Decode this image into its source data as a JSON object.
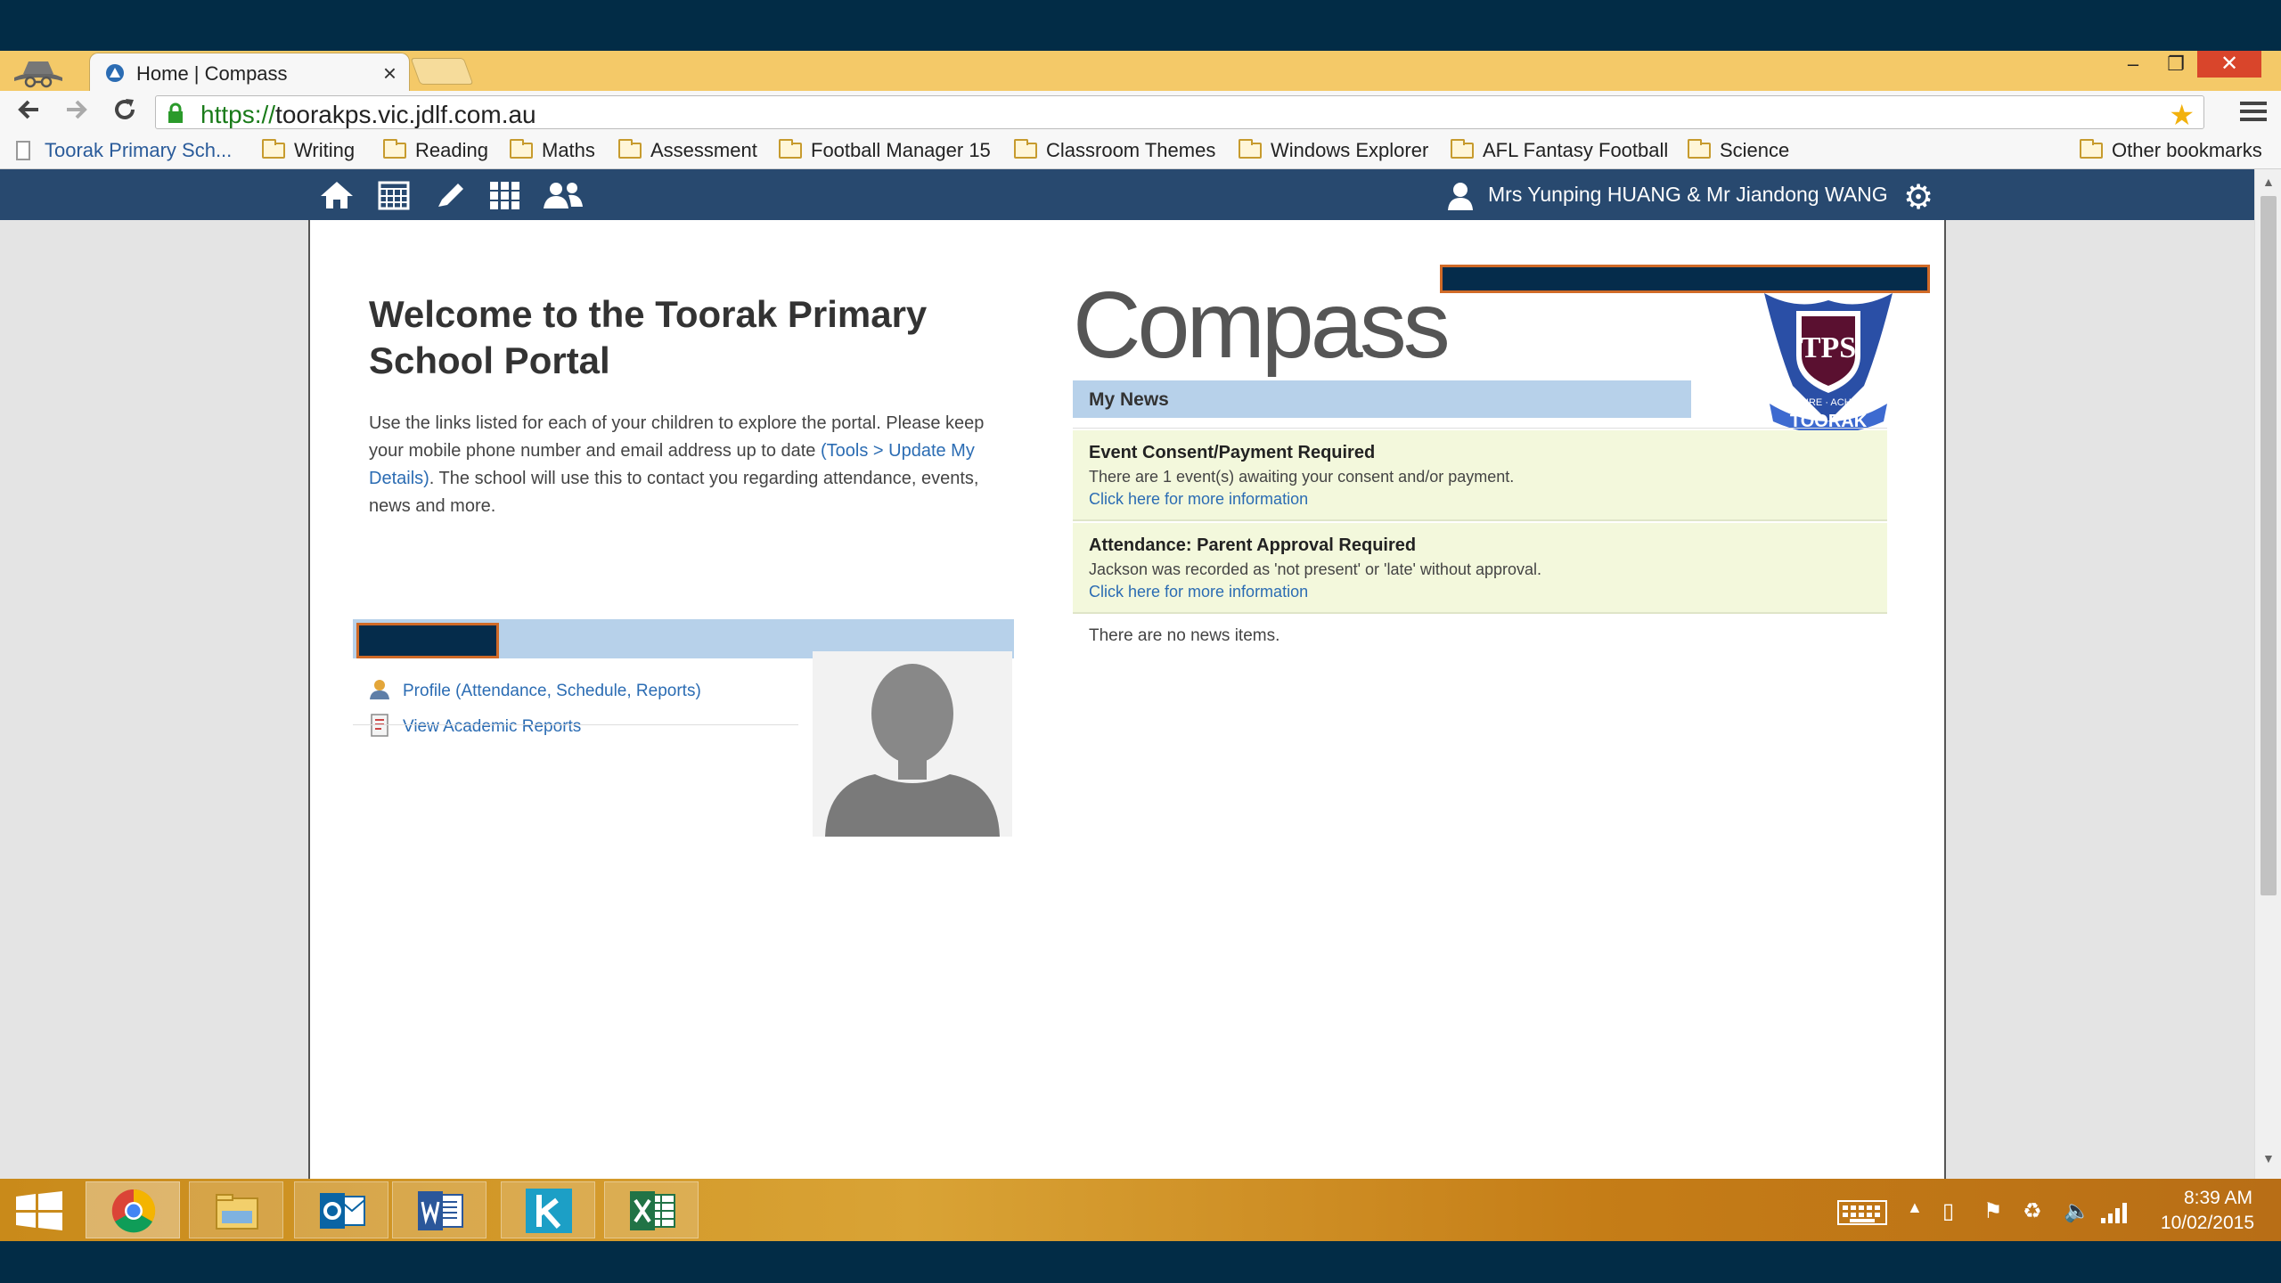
{
  "browser": {
    "tab_title": "Home | Compass",
    "tab_close": "×",
    "url_scheme": "https://",
    "url_host": "toorakps.vic.jdlf.com.au",
    "window_min": "–",
    "window_max": "❐",
    "window_close": "✕",
    "bookmarks": [
      {
        "label": "Toorak Primary Sch...",
        "type": "page"
      },
      {
        "label": "Writing",
        "type": "folder"
      },
      {
        "label": "Reading",
        "type": "folder"
      },
      {
        "label": "Maths",
        "type": "folder"
      },
      {
        "label": "Assessment",
        "type": "folder"
      },
      {
        "label": "Football Manager 15",
        "type": "folder"
      },
      {
        "label": "Classroom Themes",
        "type": "folder"
      },
      {
        "label": "Windows Explorer",
        "type": "folder"
      },
      {
        "label": "AFL Fantasy Football",
        "type": "folder"
      },
      {
        "label": "Science",
        "type": "folder"
      }
    ],
    "other_bookmarks": "Other bookmarks"
  },
  "app": {
    "nav_icons": [
      "home-icon",
      "calendar-icon",
      "pencil-icon",
      "apps-grid-icon",
      "people-icon"
    ],
    "user_name": "Mrs Yunping HUANG & Mr Jiandong WANG",
    "brand_color": "#28496f"
  },
  "page": {
    "welcome_title": "Welcome to the Toorak Primary School Portal",
    "intro_1": "Use the links listed for each of your children to explore the portal. Please keep your mobile phone number and email address up to date ",
    "intro_link": "(Tools > Update My Details)",
    "intro_2": ". The school will use this to contact you regarding attendance, events, news and more.",
    "links": [
      {
        "label": "Profile (Attendance, Schedule, Reports)",
        "icon": "profile-icon"
      },
      {
        "label": "View Academic Reports",
        "icon": "report-icon"
      }
    ],
    "logo_text": "Compass",
    "crest_letters": "TPS",
    "crest_banner": "TOORAK",
    "crest_motto": "INSPIRE · ACHIEVE"
  },
  "news": {
    "header": "My News",
    "alerts": [
      {
        "title": "Event Consent/Payment Required",
        "text": "There are 1 event(s) awaiting your consent and/or payment.",
        "link": "Click here for more information"
      },
      {
        "title": "Attendance: Parent Approval Required",
        "text": "Jackson was recorded as 'not present' or 'late' without approval.",
        "link": "Click here for more information"
      }
    ],
    "empty": "There are no news items."
  },
  "taskbar": {
    "apps": [
      "chrome-icon",
      "file-explorer-icon",
      "outlook-icon",
      "word-icon",
      "k-app-icon",
      "excel-icon"
    ],
    "time": "8:39 AM",
    "date": "10/02/2015"
  }
}
